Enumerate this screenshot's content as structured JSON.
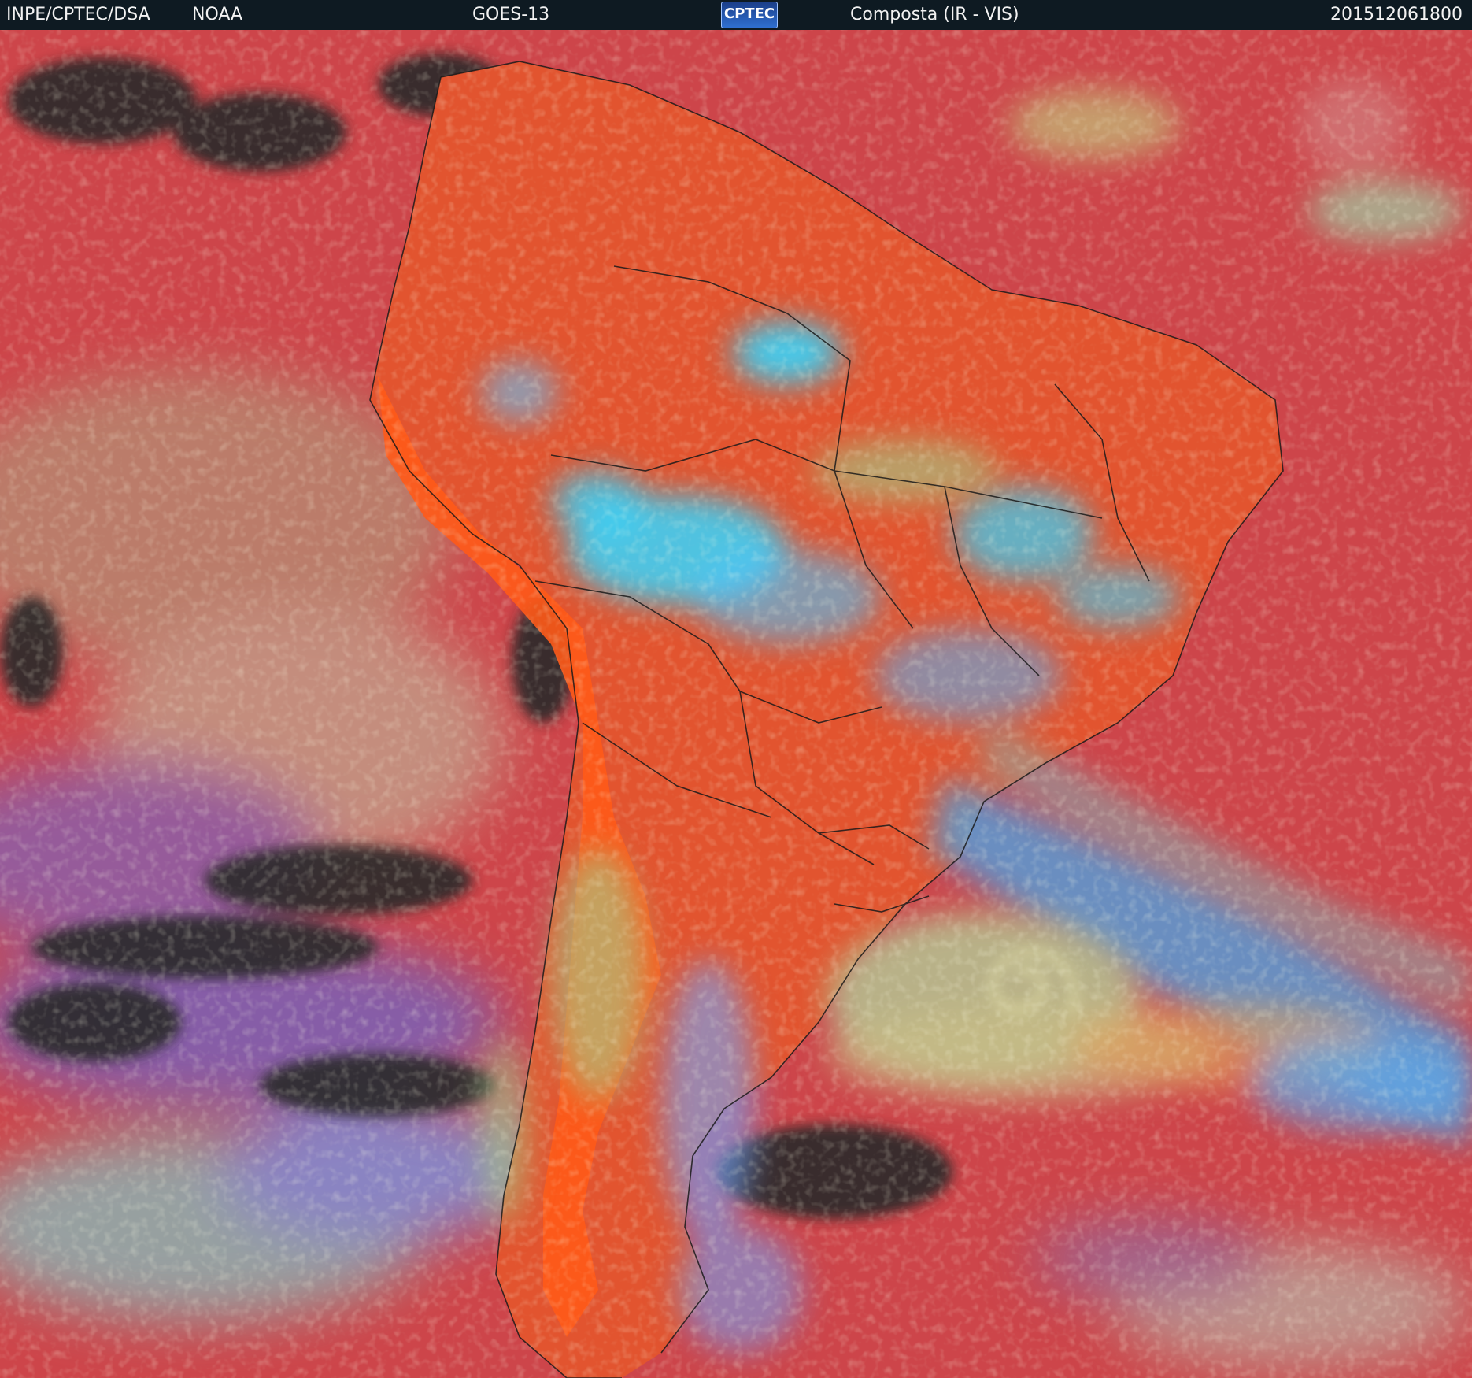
{
  "header": {
    "source_left": "INPE/CPTEC/DSA",
    "agency": "NOAA",
    "satellite": "GOES-13",
    "logo": "CPTEC",
    "product": "Composta (IR - VIS)",
    "timestamp": "201512061800"
  },
  "colors": {
    "ocean": "#c8424e",
    "land_clear": "#e2542f",
    "andes_dry": "#ff5a18",
    "cold_cloud": "#35d6ff",
    "mid_cloud": "#6fa8ff",
    "low_cloud": "#9fd28f",
    "dark_gap": "#2a2a2a",
    "header_bg": "#0e1a22"
  }
}
